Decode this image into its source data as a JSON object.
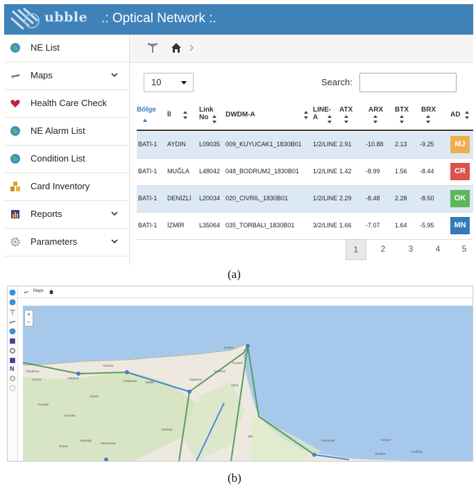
{
  "app": {
    "brand": "ubble",
    "title": ".: Optical Network :."
  },
  "colors": {
    "topbar": "#3f82b8",
    "stripe": "#dde8f5",
    "mj": "#f0ad4e",
    "cr": "#d9534f",
    "ok": "#5cb85c",
    "mn": "#337ab7",
    "sea": "#a6c9eb",
    "land": "#ede9e0"
  },
  "sidebar": {
    "items": [
      {
        "label": "NE List",
        "icon": "globe-icon",
        "has_submenu": false
      },
      {
        "label": "Maps",
        "icon": "plane-icon",
        "has_submenu": true
      },
      {
        "label": "Health Care Check",
        "icon": "heart-icon",
        "has_submenu": false
      },
      {
        "label": "NE Alarm List",
        "icon": "globe-icon",
        "has_submenu": false
      },
      {
        "label": "Condition List",
        "icon": "globe-icon",
        "has_submenu": false
      },
      {
        "label": "Card Inventory",
        "icon": "cards-icon",
        "has_submenu": false
      },
      {
        "label": "Reports",
        "icon": "report-icon",
        "has_submenu": true
      },
      {
        "label": "Parameters",
        "icon": "gear-icon",
        "has_submenu": true
      }
    ]
  },
  "breadcrumb": {
    "icons": [
      "network-icon",
      "home-icon",
      "chevron-right-icon"
    ]
  },
  "table_controls": {
    "page_length": "10",
    "search_label": "Search:",
    "search_value": ""
  },
  "table": {
    "columns": [
      {
        "label": "Bölge",
        "sort": "asc"
      },
      {
        "label": "İl",
        "sort": "both"
      },
      {
        "label": "Link No",
        "sort": "both"
      },
      {
        "label": "DWDM-A",
        "sort": "both"
      },
      {
        "label": "LINE-A",
        "sort": "both"
      },
      {
        "label": "ATX",
        "sort": "both"
      },
      {
        "label": "ARX",
        "sort": "both"
      },
      {
        "label": "BTX",
        "sort": "both"
      },
      {
        "label": "BRX",
        "sort": "both"
      },
      {
        "label": "AD",
        "sort": "both"
      }
    ],
    "rows": [
      {
        "bolge": "BATI-1",
        "il": "AYDIN",
        "link_no": "L09035",
        "dwdm_a": "009_KUYUCAK1_1830B01",
        "line_a": "1/2/LINE",
        "atx": "2.91",
        "arx": "-10.88",
        "btx": "2.13",
        "brx": "-9.25",
        "ad": "MJ"
      },
      {
        "bolge": "BATI-1",
        "il": "MUĞLA",
        "link_no": "L48042",
        "dwdm_a": "048_BODRUM2_1830B01",
        "line_a": "1/2/LINE",
        "atx": "1.42",
        "arx": "-8.99",
        "btx": "1.56",
        "brx": "-8.44",
        "ad": "CR"
      },
      {
        "bolge": "BATI-1",
        "il": "DENİZLİ",
        "link_no": "L20034",
        "dwdm_a": "020_CIVRIL_1830B01",
        "line_a": "1/2/LINE",
        "atx": "2.29",
        "arx": "-8.48",
        "btx": "2.28",
        "brx": "-8.50",
        "ad": "OK"
      },
      {
        "bolge": "BATI-1",
        "il": "İZMİR",
        "link_no": "L35064",
        "dwdm_a": "035_TORBALI_1830B01",
        "line_a": "3/2/LINE",
        "atx": "1.66",
        "arx": "-7.07",
        "btx": "1.64",
        "brx": "-5.95",
        "ad": "MN"
      }
    ]
  },
  "pagination": {
    "pages": [
      "1",
      "2",
      "3",
      "4",
      "5"
    ],
    "active": "1"
  },
  "captions": {
    "a": "(a)",
    "b": "(b)"
  },
  "map_view": {
    "breadcrumb_label": "Maps",
    "zoom_in": "+",
    "zoom_out": "−",
    "sidebar_letter": "N",
    "place_labels": [
      "Akçakoca",
      "Düzce",
      "Kocaali",
      "Sakarya",
      "Karasu",
      "Akyazı",
      "Hendek",
      "Adapazarı",
      "Kaynaşlı",
      "Pamukova",
      "Geyve",
      "Taraklı",
      "Sapanca",
      "Kartepe",
      "Kandıra",
      "Kefken",
      "Kocaeli",
      "Ağva",
      "Şile",
      "Sarıyer",
      "Beykoz",
      "Ümraniye",
      "Kadıköy"
    ]
  }
}
